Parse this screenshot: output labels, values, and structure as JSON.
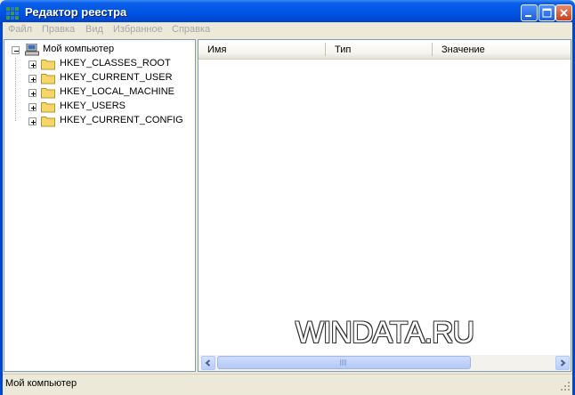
{
  "window": {
    "title": "Редактор реестра",
    "controls": {
      "minimize": "minimize",
      "maximize": "maximize",
      "close": "close"
    }
  },
  "menu": {
    "items": [
      "Файл",
      "Правка",
      "Вид",
      "Избранное",
      "Справка"
    ]
  },
  "tree": {
    "root": {
      "label": "Мой компьютер",
      "icon": "computer-icon",
      "expanded": true
    },
    "keys": [
      {
        "label": "HKEY_CLASSES_ROOT"
      },
      {
        "label": "HKEY_CURRENT_USER"
      },
      {
        "label": "HKEY_LOCAL_MACHINE"
      },
      {
        "label": "HKEY_USERS"
      },
      {
        "label": "HKEY_CURRENT_CONFIG"
      }
    ]
  },
  "list": {
    "columns": [
      "Имя",
      "Тип",
      "Значение"
    ],
    "rows": []
  },
  "watermark": "WINDATA.RU",
  "status": {
    "text": "Мой компьютер"
  },
  "colors": {
    "titlebar": "#0055e5",
    "menu_disabled": "#a7a6aa",
    "folder": "#f5d66a"
  }
}
